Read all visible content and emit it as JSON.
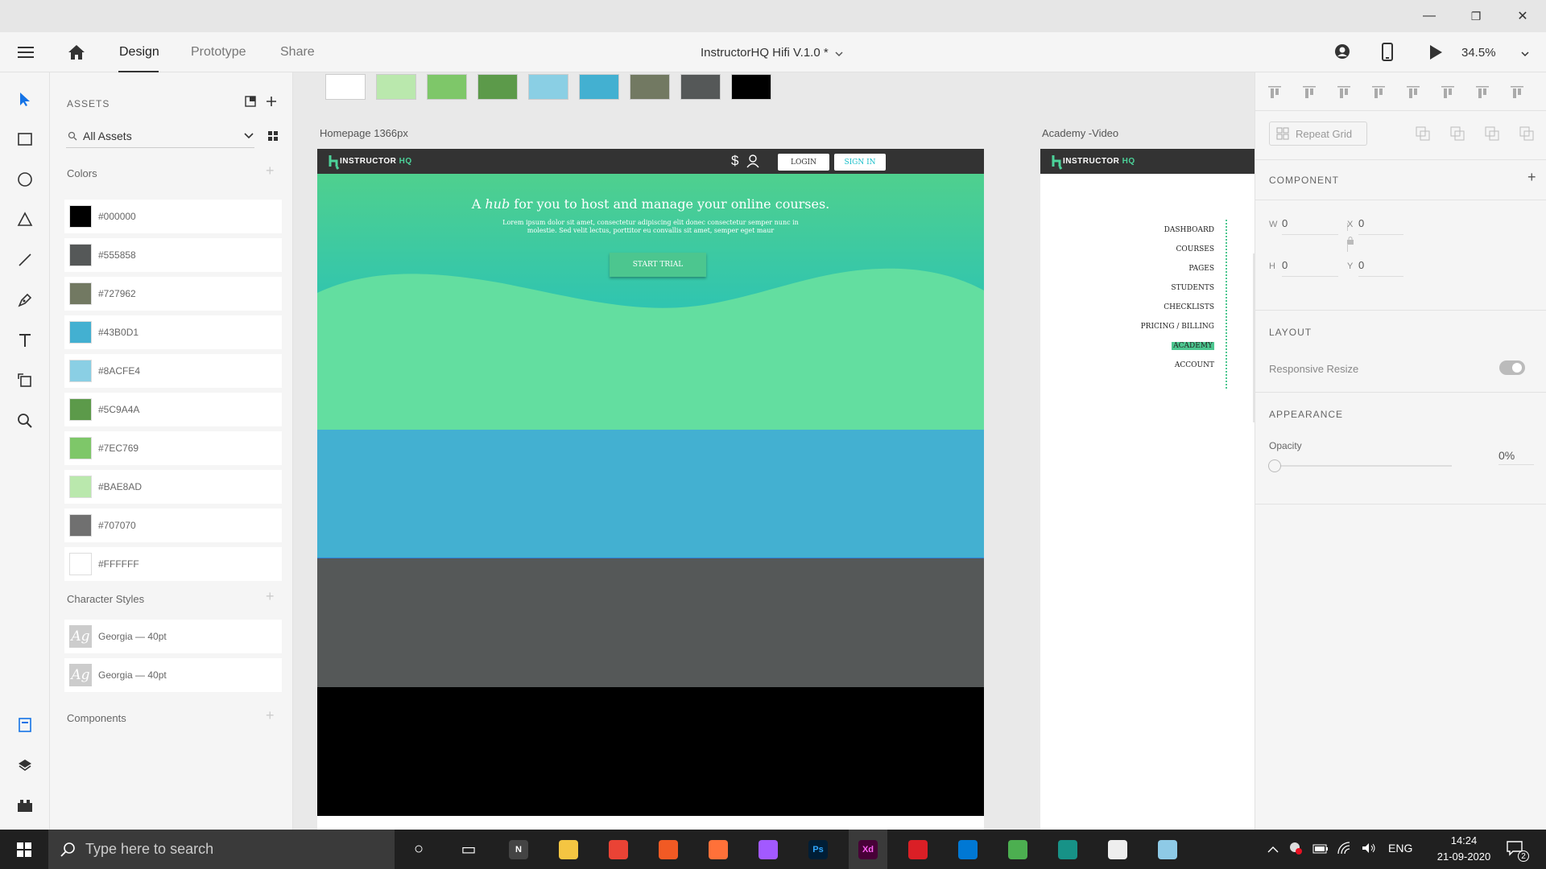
{
  "window": {
    "minimize": "—",
    "maximize": "❐",
    "close": "✕"
  },
  "appbar": {
    "tabs": [
      "Design",
      "Prototype",
      "Share"
    ],
    "doc_title": "InstructorHQ Hifi V.1.0 *",
    "zoom": "34.5%"
  },
  "assets": {
    "header": "ASSETS",
    "filter": "All Assets",
    "colors_title": "Colors",
    "colors": [
      {
        "hex": "#000000",
        "label": "#000000"
      },
      {
        "hex": "#555858",
        "label": "#555858"
      },
      {
        "hex": "#727962",
        "label": "#727962"
      },
      {
        "hex": "#43B0D1",
        "label": "#43B0D1"
      },
      {
        "hex": "#8ACFE4",
        "label": "#8ACFE4"
      },
      {
        "hex": "#5C9A4A",
        "label": "#5C9A4A"
      },
      {
        "hex": "#7EC769",
        "label": "#7EC769"
      },
      {
        "hex": "#BAE8AD",
        "label": "#BAE8AD"
      },
      {
        "hex": "#707070",
        "label": "#707070"
      },
      {
        "hex": "#FFFFFF",
        "label": "#FFFFFF"
      }
    ],
    "char_title": "Character Styles",
    "char_styles": [
      {
        "glyph": "Ag",
        "label": "Georgia — 40pt"
      },
      {
        "glyph": "Ag",
        "label": "Georgia — 40pt"
      }
    ],
    "components_title": "Components"
  },
  "canvas": {
    "top_swatches": [
      "#FFFFFF",
      "#BAE8AD",
      "#7EC769",
      "#5C9A4A",
      "#8ACFE4",
      "#43B0D1",
      "#727962",
      "#555858",
      "#000000"
    ],
    "artboard1": {
      "label": "Homepage 1366px",
      "logo_a": "INSTRUCTOR",
      "logo_b": "HQ",
      "login": "LOGIN",
      "signin": "SIGN IN",
      "hero_title_pre": "A ",
      "hero_title_em": "hub",
      "hero_title_post": " for you to host and manage your online courses.",
      "hero_sub": "Lorem ipsum dolor sit amet, consectetur adipiscing elit donec consectetur semper nunc in molestie. Sed velit lectus, porttitor eu convallis sit amet, semper eget maur",
      "cta": "START TRIAL"
    },
    "artboard2": {
      "label": "Academy -Video",
      "logo_a": "INSTRUCTOR",
      "logo_b": "HQ",
      "nav": [
        "DASHBOARD",
        "COURSES",
        "PAGES",
        "STUDENTS",
        "CHECKLISTS",
        "PRICING / BILLING",
        "ACADEMY",
        "ACCOUNT"
      ],
      "active_nav": "ACADEMY"
    }
  },
  "props": {
    "repeat_grid": "Repeat Grid",
    "component_title": "COMPONENT",
    "w_label": "W",
    "w_value": "0",
    "x_label": "X",
    "x_value": "0",
    "h_label": "H",
    "h_value": "0",
    "y_label": "Y",
    "y_value": "0",
    "layout_title": "LAYOUT",
    "responsive": "Responsive Resize",
    "appearance_title": "APPEARANCE",
    "opacity_label": "Opacity",
    "opacity_value": "0%"
  },
  "taskbar": {
    "search": "Type here to search",
    "lang": "ENG",
    "time": "14:24",
    "date": "21-09-2020",
    "notif": "2"
  }
}
